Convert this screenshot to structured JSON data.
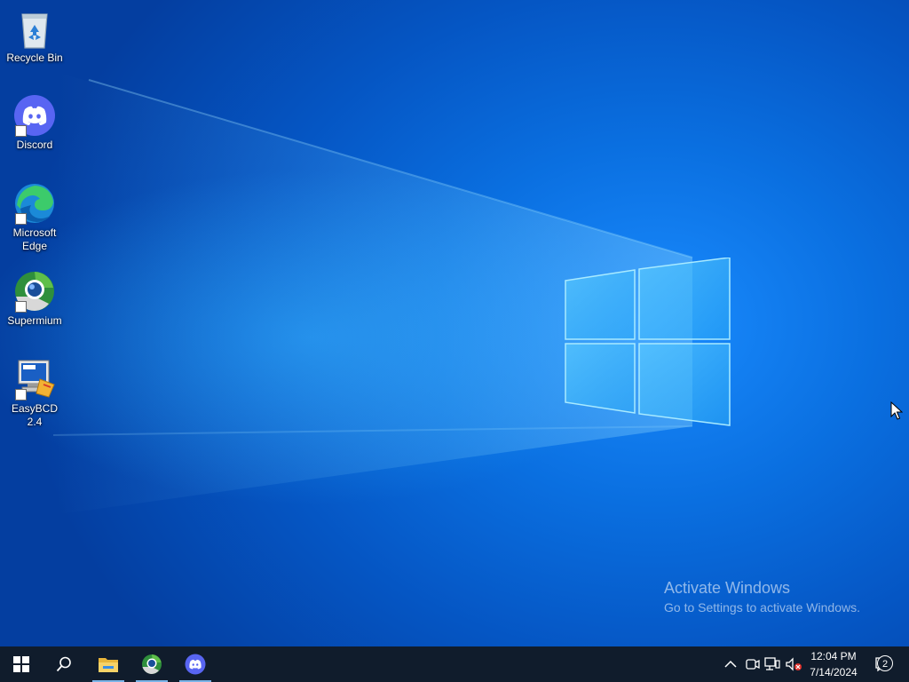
{
  "desktop": {
    "icons": [
      {
        "label": "Recycle Bin",
        "icon": "recycle-bin-icon"
      },
      {
        "label": "Discord",
        "icon": "discord-icon"
      },
      {
        "label": "Microsoft Edge",
        "icon": "edge-icon"
      },
      {
        "label": "Supermium",
        "icon": "supermium-icon"
      },
      {
        "label": "EasyBCD 2.4",
        "icon": "easybcd-icon"
      }
    ],
    "watermark": {
      "line1": "Activate Windows",
      "line2": "Go to Settings to activate Windows."
    }
  },
  "taskbar": {
    "start_icon": "windows-start-icon",
    "search_icon": "search-icon",
    "pinned": [
      {
        "icon": "file-explorer-icon",
        "running": true
      },
      {
        "icon": "supermium-icon",
        "running": true
      },
      {
        "icon": "discord-icon",
        "running": true
      }
    ],
    "tray": {
      "time": "12:04 PM",
      "date": "7/14/2024",
      "notification_count": "2"
    }
  },
  "colors": {
    "taskbar_bg": "#101c2c",
    "desktop_accent": "#0a6fe0",
    "discord_blurple": "#5865f2"
  }
}
